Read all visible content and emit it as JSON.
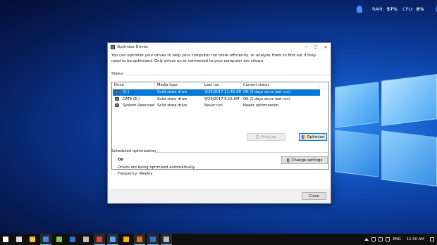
{
  "monitor": {
    "ram_label": "RAM:",
    "ram_value": "57%",
    "cpu_label": "CPU:",
    "cpu_value": "8%"
  },
  "window": {
    "title": "Optimize Drives",
    "intro": "You can optimize your drives to help your computer run more efficiently, or analyze them to find out if they need to be optimized. Only drives on or connected to your computer are shown.",
    "status_label": "Status",
    "columns": [
      "Drive",
      "Media type",
      "Last run",
      "Current status"
    ],
    "drives": [
      {
        "drive": "(C:)",
        "media": "Solid state drive",
        "last_run": "9/30/2017 11:48 AM",
        "status": "OK (0 days since last run)"
      },
      {
        "drive": "DATA (E:)",
        "media": "Solid state drive",
        "last_run": "9/29/2017 8:15 AM",
        "status": "OK (1 days since last run)"
      },
      {
        "drive": "System Reserved",
        "media": "Solid state drive",
        "last_run": "Never run",
        "status": "Needs optimization"
      }
    ],
    "analyze_label": "Analyze",
    "optimize_label": "Optimize",
    "scheduled_label": "Scheduled optimization",
    "sched_state": "On",
    "sched_desc": "Drives are being optimized automatically.",
    "sched_freq": "Frequency: Weekly",
    "change_settings_label": "Change settings",
    "close_label": "Close"
  },
  "tray": {
    "lang": "ENG",
    "time": "11:50 AM"
  },
  "taskbar_apps": [
    {
      "name": "start-icon",
      "color": "#ffffff"
    },
    {
      "name": "task-view-icon",
      "color": "#dddddd"
    },
    {
      "name": "file-explorer-icon",
      "color": "#f2c43c"
    },
    {
      "name": "edge-icon",
      "color": "#2d8ee6"
    },
    {
      "name": "android-icon",
      "color": "#8bc34a"
    },
    {
      "name": "photoshop-icon",
      "color": "#2f6fd6"
    },
    {
      "name": "settings-icon",
      "color": "#bbbbbb"
    },
    {
      "name": "media-icon",
      "color": "#e0433b"
    },
    {
      "name": "windows-app-icon",
      "color": "#5aa0ff"
    },
    {
      "name": "chrome-icon",
      "color": "#f4b400"
    },
    {
      "name": "office-icon",
      "color": "#e86d2a"
    },
    {
      "name": "photoshop-2-icon",
      "color": "#2f6fd6"
    },
    {
      "name": "utility-icon",
      "color": "#bbbbbb"
    }
  ]
}
